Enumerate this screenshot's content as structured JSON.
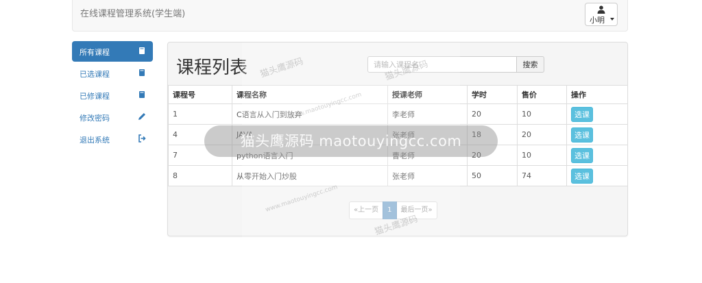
{
  "navbar": {
    "brand": "在线课程管理系统(学生端)",
    "user_name": "小明"
  },
  "sidebar": {
    "items": [
      {
        "label": "所有课程",
        "icon": "book-icon",
        "active": true
      },
      {
        "label": "已选课程",
        "icon": "book-icon",
        "active": false
      },
      {
        "label": "已修课程",
        "icon": "book-icon",
        "active": false
      },
      {
        "label": "修改密码",
        "icon": "pencil-icon",
        "active": false
      },
      {
        "label": "退出系统",
        "icon": "logout-icon",
        "active": false
      }
    ]
  },
  "main": {
    "title": "课程列表",
    "search": {
      "placeholder": "请输入课程名",
      "button": "搜索"
    },
    "table": {
      "headers": [
        "课程号",
        "课程名称",
        "授课老师",
        "学时",
        "售价",
        "操作"
      ],
      "rows": [
        {
          "id": "1",
          "name": "C语言从入门到放弃",
          "teacher": "李老师",
          "hours": "20",
          "price": "10",
          "action": "选课"
        },
        {
          "id": "4",
          "name": "JAVA",
          "teacher": "张老师",
          "hours": "18",
          "price": "20",
          "action": "选课"
        },
        {
          "id": "7",
          "name": "python语言入门",
          "teacher": "曹老师",
          "hours": "20",
          "price": "10",
          "action": "选课"
        },
        {
          "id": "8",
          "name": "从零开始入门炒股",
          "teacher": "张老师",
          "hours": "50",
          "price": "74",
          "action": "选课"
        }
      ]
    },
    "pagination": {
      "prev": "«上一页",
      "current": "1",
      "last": "最后一页»"
    }
  },
  "watermark": {
    "band": "猫头鹰源码 maotouyingcc.com",
    "small_cn": "猫头鹰源码",
    "small_en": "www.maotouyingcc.com"
  },
  "colors": {
    "primary": "#337ab7",
    "info": "#5bc0de",
    "navbar_bg": "#f8f8f8",
    "panel_bg": "#f5f5f5"
  }
}
